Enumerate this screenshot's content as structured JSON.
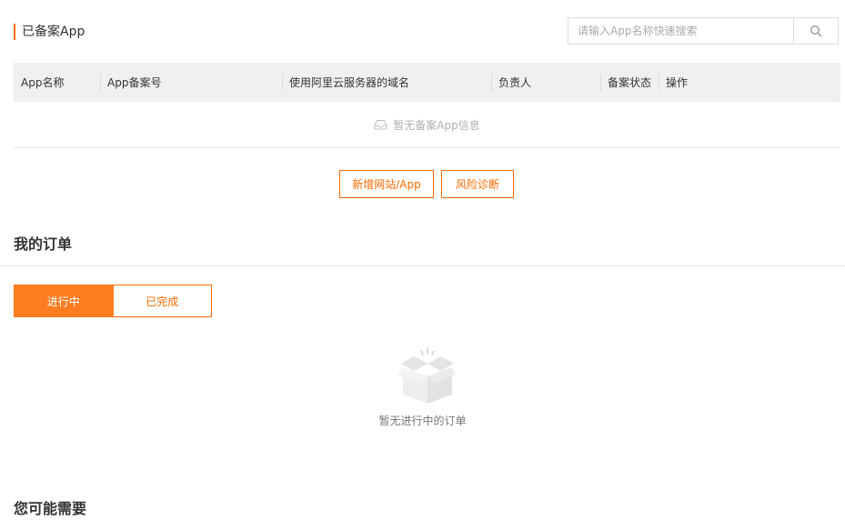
{
  "filed_apps": {
    "title": "已备案App",
    "search_placeholder": "请输入App名称快速搜索",
    "columns": [
      "App名称",
      "App备案号",
      "使用阿里云服务器的域名",
      "负责人",
      "备案状态",
      "操作"
    ],
    "empty_text": "暂无备案App信息",
    "actions": {
      "add_label": "新增网站/App",
      "risk_label": "风险诊断"
    }
  },
  "orders": {
    "title": "我的订单",
    "tabs": [
      "进行中",
      "已完成"
    ],
    "active_tab": "进行中",
    "empty_text": "暂无进行中的订单"
  },
  "recommend": {
    "title": "您可能需要"
  },
  "colors": {
    "accent": "#ff6a00",
    "tab_active": "#ff7d21"
  },
  "icons": {
    "search": "search-icon",
    "empty_inbox": "empty-inbox-icon",
    "empty_box": "empty-box-icon"
  }
}
